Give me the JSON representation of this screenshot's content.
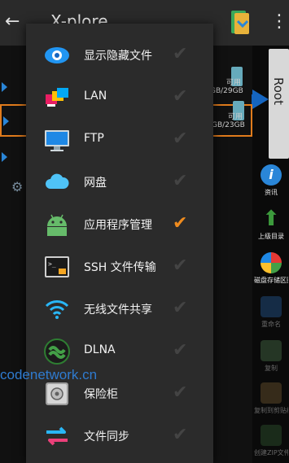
{
  "appbar": {
    "title": "X-plore"
  },
  "devices": [
    {
      "free_label": "可用",
      "size_label": "GB/29GB"
    },
    {
      "free_label": "可用",
      "size_label": "GB/23GB"
    }
  ],
  "root_tab": {
    "label": "Root"
  },
  "rail": [
    {
      "name": "info",
      "label": "资讯",
      "color": "#2a86d8"
    },
    {
      "name": "parent-dir",
      "label": "上级目录",
      "color": "#3c9a3c"
    },
    {
      "name": "storage-map",
      "label": "磁盘存储区图",
      "color": "#ffffff"
    },
    {
      "name": "rename",
      "label": "重命名",
      "color": "#2a6cb8"
    },
    {
      "name": "copy",
      "label": "复制",
      "color": "#5a8a5a"
    },
    {
      "name": "zip-copy",
      "label": "复制到剪贴板",
      "color": "#8a6a3a"
    },
    {
      "name": "zip-create",
      "label": "创建ZIP文件",
      "color": "#3a6a3a"
    }
  ],
  "menu": {
    "items": [
      {
        "label": "显示隐藏文件",
        "icon": "eye-icon",
        "checked": false
      },
      {
        "label": "LAN",
        "icon": "lan-icon",
        "checked": false
      },
      {
        "label": "FTP",
        "icon": "ftp-monitor-icon",
        "checked": false
      },
      {
        "label": "网盘",
        "icon": "cloud-icon",
        "checked": false
      },
      {
        "label": "应用程序管理",
        "icon": "android-icon",
        "checked": true
      },
      {
        "label": "SSH 文件传输",
        "icon": "terminal-icon",
        "checked": false
      },
      {
        "label": "无线文件共享",
        "icon": "wifi-icon",
        "checked": false
      },
      {
        "label": "DLNA",
        "icon": "dlna-icon",
        "checked": false
      },
      {
        "label": "保险柜",
        "icon": "vault-icon",
        "checked": false
      },
      {
        "label": "文件同步",
        "icon": "sync-icon",
        "checked": false
      }
    ]
  },
  "watermark": "codenetwork.cn"
}
